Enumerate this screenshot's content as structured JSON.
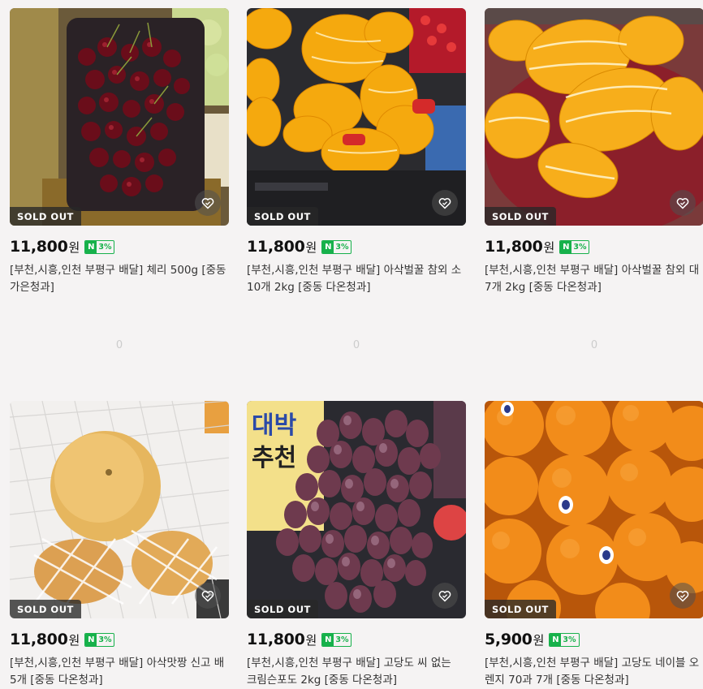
{
  "products": [
    {
      "sold_out": "SOLD OUT",
      "price": "11,800",
      "unit": "원",
      "badge_n": "N",
      "badge_pct": "3%",
      "title": "[부천,시흥,인천 부평구 배달] 체리 500g [중동 가은청과]",
      "count": "0",
      "image": "cherries"
    },
    {
      "sold_out": "SOLD OUT",
      "price": "11,800",
      "unit": "원",
      "badge_n": "N",
      "badge_pct": "3%",
      "title": "[부천,시흥,인천 부평구 배달] 아삭벌꿀 참외 소 10개 2kg [중동 다온청과]",
      "count": "0",
      "image": "melons-small"
    },
    {
      "sold_out": "SOLD OUT",
      "price": "11,800",
      "unit": "원",
      "badge_n": "N",
      "badge_pct": "3%",
      "title": "[부천,시흥,인천 부평구 배달] 아삭벌꿀 참외 대 7개 2kg [중동 다온청과]",
      "count": "0",
      "image": "melons-large"
    },
    {
      "sold_out": "SOLD OUT",
      "price": "11,800",
      "unit": "원",
      "badge_n": "N",
      "badge_pct": "3%",
      "title": "[부천,시흥,인천 부평구 배달] 아삭맛짱 신고 배 5개 [중동 다온청과]",
      "image": "pears"
    },
    {
      "sold_out": "SOLD OUT",
      "price": "11,800",
      "unit": "원",
      "badge_n": "N",
      "badge_pct": "3%",
      "title": "[부천,시흥,인천 부평구 배달] 고당도 씨 없는 크림슨포도 2kg [중동 다온청과]",
      "image": "grapes",
      "sign_text_1": "대박",
      "sign_text_2": "추천"
    },
    {
      "sold_out": "SOLD OUT",
      "price": "5,900",
      "unit": "원",
      "badge_n": "N",
      "badge_pct": "3%",
      "title": "[부천,시흥,인천 부평구 배달] 고당도 네이블 오렌지 70과 7개 [중동 다온청과]",
      "image": "oranges"
    }
  ],
  "colors": {
    "npay_green": "#17b14b",
    "soldout_bg": "#282828"
  }
}
